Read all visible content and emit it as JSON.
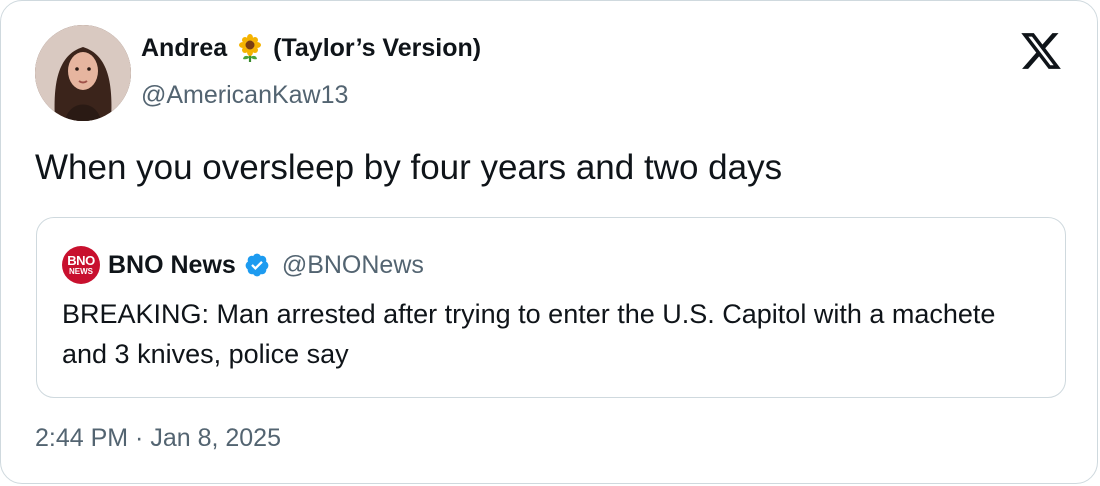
{
  "tweet": {
    "author_name_prefix": "Andrea",
    "author_name_suffix": "(Taylor’s Version)",
    "author_emoji": "sunflower-icon",
    "handle": "@AmericanKaw13",
    "text": "When you oversleep by four years and two days",
    "timestamp": "2:44 PM · Jan 8, 2025"
  },
  "quote": {
    "logo_line1": "BNO",
    "logo_line2": "NEWS",
    "name": "BNO News",
    "handle": "@BNONews",
    "text": "BREAKING: Man arrested after trying to enter the U.S. Capitol with a machete and 3 knives, police say"
  },
  "colors": {
    "text_primary": "#0f1419",
    "text_secondary": "#536471",
    "border": "#cfd9de",
    "verified_blue": "#1d9bf0",
    "bno_red": "#c8102e"
  }
}
